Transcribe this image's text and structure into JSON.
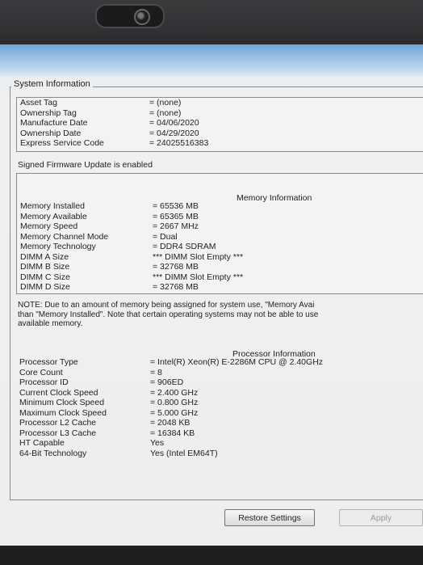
{
  "group_title": "System Information",
  "system": {
    "rows": [
      {
        "label": "Asset Tag",
        "value": "= (none)"
      },
      {
        "label": "Ownership Tag",
        "value": "= (none)"
      },
      {
        "label": "Manufacture Date",
        "value": "= 04/06/2020"
      },
      {
        "label": "Ownership Date",
        "value": "= 04/29/2020"
      },
      {
        "label": "Express Service Code",
        "value": "= 24025516383"
      }
    ]
  },
  "signed_firmware": "Signed Firmware Update is enabled",
  "memory": {
    "header": "Memory Information",
    "rows": [
      {
        "label": "Memory Installed",
        "value": "= 65536 MB"
      },
      {
        "label": "Memory Available",
        "value": "= 65365 MB"
      },
      {
        "label": "Memory Speed",
        "value": "= 2667 MHz"
      },
      {
        "label": "Memory Channel Mode",
        "value": "= Dual"
      },
      {
        "label": "Memory Technology",
        "value": "= DDR4 SDRAM"
      },
      {
        "label": "DIMM A Size",
        "value": "*** DIMM Slot Empty ***"
      },
      {
        "label": "DIMM B Size",
        "value": "= 32768 MB"
      },
      {
        "label": "DIMM C Size",
        "value": "*** DIMM Slot Empty ***"
      },
      {
        "label": "DIMM D Size",
        "value": "= 32768 MB"
      }
    ]
  },
  "note": {
    "line1": "NOTE: Due to an amount of memory being assigned for system use, \"Memory Avai",
    "line2": "than \"Memory Installed\". Note that certain operating systems may not be able to use",
    "line3": "available memory."
  },
  "processor": {
    "header": "Processor Information",
    "rows": [
      {
        "label": "Processor Type",
        "value": "= Intel(R) Xeon(R) E-2286M CPU @ 2.40GHz"
      },
      {
        "label": "Core Count",
        "value": "= 8"
      },
      {
        "label": "Processor ID",
        "value": "= 906ED"
      },
      {
        "label": "Current Clock Speed",
        "value": "= 2.400 GHz"
      },
      {
        "label": "Minimum Clock Speed",
        "value": "= 0.800 GHz"
      },
      {
        "label": "Maximum Clock Speed",
        "value": "= 5.000 GHz"
      },
      {
        "label": "Processor L2 Cache",
        "value": "= 2048 KB"
      },
      {
        "label": "Processor L3 Cache",
        "value": "= 16384 KB"
      },
      {
        "label": "HT Capable",
        "value": "Yes"
      },
      {
        "label": "64-Bit Technology",
        "value": "Yes (Intel EM64T)"
      }
    ]
  },
  "buttons": {
    "restore": "Restore Settings",
    "apply": "Apply"
  }
}
